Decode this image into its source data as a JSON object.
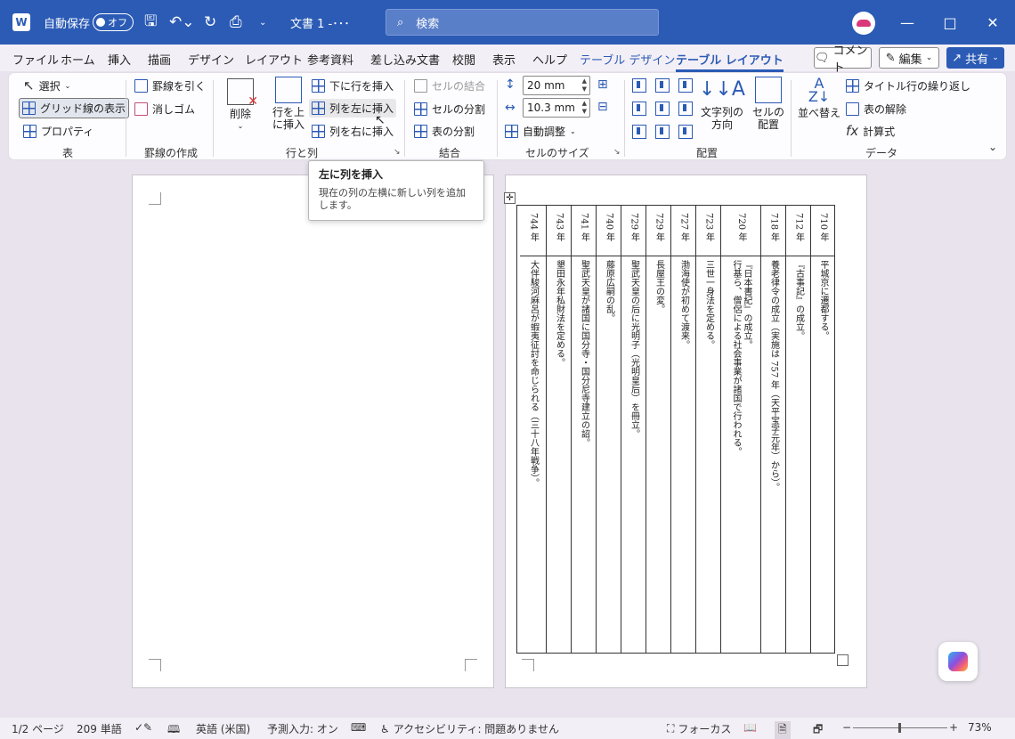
{
  "titlebar": {
    "autosave_label": "自動保存",
    "autosave_state": "オフ",
    "doc_title": "文書 1 -･･･",
    "search_placeholder": "検索"
  },
  "menu": {
    "tabs": [
      "ファイル",
      "ホーム",
      "挿入",
      "描画",
      "デザイン",
      "レイアウト",
      "参考資料",
      "差し込み文書",
      "校閲",
      "表示",
      "ヘルプ",
      "テーブル デザイン",
      "テーブル レイアウト"
    ],
    "comment_label": "コメント",
    "edit_label": "編集",
    "share_label": "共有"
  },
  "ribbon": {
    "table_group": {
      "select": "選択",
      "gridlines": "グリッド線の表示",
      "properties": "プロパティ",
      "label": "表"
    },
    "draw_group": {
      "draw_border": "罫線を引く",
      "eraser": "消しゴム",
      "label": "罫線の作成"
    },
    "rows_cols": {
      "delete": "削除",
      "insert_above": "行を上\nに挿入",
      "insert_below": "下に行を挿入",
      "insert_left": "列を左に挿入",
      "insert_right": "列を右に挿入",
      "label": "行と列"
    },
    "merge": {
      "merge_cells": "セルの結合",
      "split_cells": "セルの分割",
      "split_table": "表の分割",
      "label": "結合"
    },
    "cell_size": {
      "height": "20 mm",
      "width": "10.3 mm",
      "autofit": "自動調整",
      "label": "セルのサイズ"
    },
    "alignment": {
      "text_direction": "文字列の\n方向",
      "cell_margins": "セルの\n配置",
      "label": "配置"
    },
    "data": {
      "sort": "並べ替え",
      "repeat_header": "タイトル行の繰り返し",
      "convert": "表の解除",
      "formula": "計算式",
      "label": "データ"
    }
  },
  "tooltip": {
    "title": "左に列を挿入",
    "body": "現在の列の左横に新しい列を追加します。"
  },
  "table": {
    "columns": [
      {
        "year": "710 年",
        "event": "平城京に遷都する。"
      },
      {
        "year": "712 年",
        "event": "『古事記』の成立。"
      },
      {
        "year": "718 年",
        "event": "養老律令の成立（実施は 757 年（天平宝字元年）から）。"
      },
      {
        "year": "720 年",
        "event": "『日本書紀』の成立。\n行基ら、僧侶による社会事業が諸国で行われる。"
      },
      {
        "year": "723 年",
        "event": "三世一身法を定める。"
      },
      {
        "year": "727 年",
        "event": "渤海使が初めて渡来。"
      },
      {
        "year": "729 年",
        "event": "長屋王の変。"
      },
      {
        "year": "729 年",
        "event": "聖武天皇の后に光明子（光明皇后）を冊立。"
      },
      {
        "year": "740 年",
        "event": "藤原広嗣の乱。"
      },
      {
        "year": "741 年",
        "event": "聖武天皇が諸国に国分寺・国分尼寺建立の詔。"
      },
      {
        "year": "743 年",
        "event": "墾田永年私財法を定める。"
      },
      {
        "year": "744 年",
        "event": "大伴駿河麻呂が蝦夷征討を命じられる（三十八年戦争）。"
      }
    ]
  },
  "statusbar": {
    "page": "1/2 ページ",
    "words": "209 単語",
    "language": "英語 (米国)",
    "predict": "予測入力: オン",
    "accessibility": "アクセシビリティ: 問題ありません",
    "focus": "フォーカス",
    "zoom": "73%"
  },
  "colors": {
    "accent": "#2b5bb5",
    "canvas": "#e8e3ec"
  }
}
